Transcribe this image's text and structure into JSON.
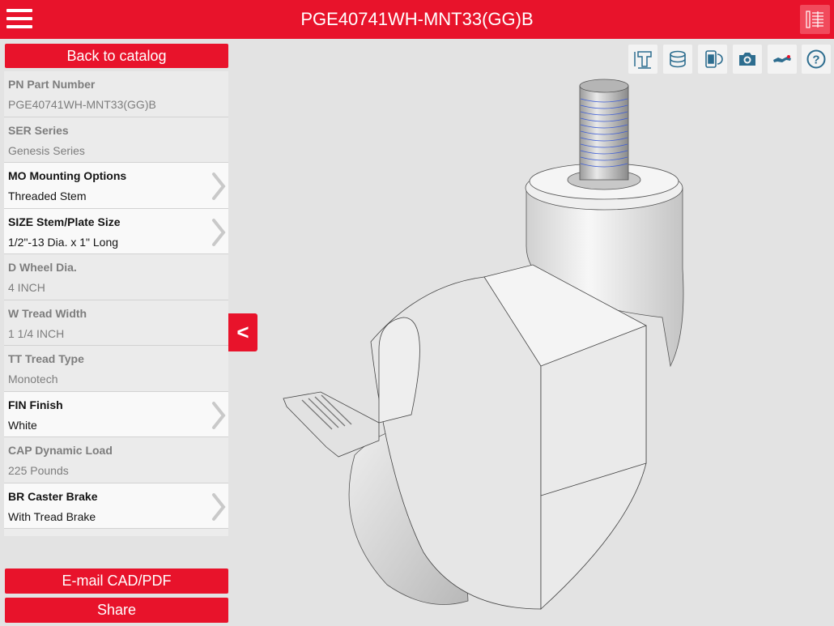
{
  "header": {
    "title": "PGE40741WH-MNT33(GG)B",
    "menu_icon": "hamburger-menu-icon",
    "view_icon": "list-view-icon"
  },
  "sidebar": {
    "back_label": "Back to catalog",
    "collapse_label": "<",
    "email_label": "E-mail CAD/PDF",
    "share_label": "Share",
    "specs": [
      {
        "label": "PN Part Number",
        "value": "PGE40741WH-MNT33(GG)B",
        "editable": false
      },
      {
        "label": "SER Series",
        "value": "Genesis Series",
        "editable": false
      },
      {
        "label": "MO Mounting Options",
        "value": "Threaded Stem",
        "editable": true
      },
      {
        "label": "SIZE Stem/Plate Size",
        "value": "1/2\"-13 Dia. x 1\" Long",
        "editable": true
      },
      {
        "label": "D Wheel Dia.",
        "value": "4 INCH",
        "editable": false
      },
      {
        "label": "W Tread Width",
        "value": "1 1/4 INCH",
        "editable": false
      },
      {
        "label": "TT Tread Type",
        "value": "Monotech",
        "editable": false
      },
      {
        "label": "FIN Finish",
        "value": "White",
        "editable": true
      },
      {
        "label": "CAP Dynamic Load",
        "value": "225 Pounds",
        "editable": false
      },
      {
        "label": "BR Caster Brake",
        "value": "With Tread Brake",
        "editable": true
      }
    ]
  },
  "toolbar": {
    "icons": [
      "dimension-icon",
      "cylinder-icon",
      "mobile-ar-icon",
      "camera-icon",
      "handshake-icon",
      "help-icon"
    ]
  },
  "colors": {
    "brand_red": "#e8132b",
    "toolbar_icon": "#2d6d8f"
  }
}
